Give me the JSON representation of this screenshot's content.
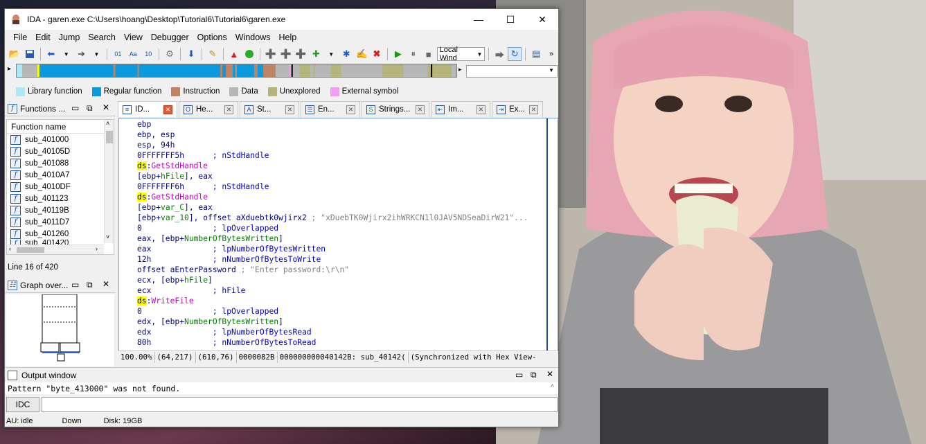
{
  "window": {
    "title": "IDA - garen.exe C:\\Users\\hoang\\Desktop\\Tutorial6\\Tutorial6\\garen.exe",
    "minimize": "—",
    "maximize": "☐",
    "close": "✕"
  },
  "menu": [
    "File",
    "Edit",
    "Jump",
    "Search",
    "View",
    "Debugger",
    "Options",
    "Windows",
    "Help"
  ],
  "toolbar": {
    "debugger_select": "Local Wind"
  },
  "legend": [
    {
      "label": "Library function",
      "color": "#aee8f7"
    },
    {
      "label": "Regular function",
      "color": "#0b9ade"
    },
    {
      "label": "Instruction",
      "color": "#bf8263"
    },
    {
      "label": "Data",
      "color": "#b7b7b7"
    },
    {
      "label": "Unexplored",
      "color": "#b5b57a"
    },
    {
      "label": "External symbol",
      "color": "#f59cf5"
    }
  ],
  "functions_panel": {
    "title": "Functions ...",
    "column": "Function name",
    "items": [
      "sub_401000",
      "sub_40105D",
      "sub_401088",
      "sub_4010A7",
      "sub_4010DF",
      "sub_401123",
      "sub_40119B",
      "sub_4011D7",
      "sub_401260",
      "sub_401420"
    ]
  },
  "line_status": "Line 16 of 420",
  "graph_panel": {
    "title": "Graph over..."
  },
  "tabs": [
    {
      "label": "ID...",
      "icon": "disassembly-icon",
      "active": true
    },
    {
      "label": "He...",
      "icon": "hex-view-icon"
    },
    {
      "label": "St...",
      "icon": "structures-icon"
    },
    {
      "label": "En...",
      "icon": "enums-icon"
    },
    {
      "label": "Strings...",
      "icon": "strings-icon"
    },
    {
      "label": "Im...",
      "icon": "imports-icon"
    },
    {
      "label": "Ex...",
      "icon": "exports-icon"
    }
  ],
  "disassembly": [
    [
      {
        "t": "ebp",
        "c": "op"
      }
    ],
    [
      {
        "t": "ebp, esp",
        "c": "op"
      }
    ],
    [
      {
        "t": "esp, 94h",
        "c": "op"
      }
    ],
    [
      {
        "t": "0FFFFFFF5h      ",
        "c": "op"
      },
      {
        "t": "; nStdHandle",
        "c": "cmt"
      }
    ],
    [
      {
        "t": "ds",
        "c": "seg"
      },
      {
        "t": ":",
        "c": "op"
      },
      {
        "t": "GetStdHandle",
        "c": "api"
      }
    ],
    [
      {
        "t": "[ebp+",
        "c": "op"
      },
      {
        "t": "hFile",
        "c": "var"
      },
      {
        "t": "], eax",
        "c": "op"
      }
    ],
    [
      {
        "t": "0FFFFFFF6h      ",
        "c": "op"
      },
      {
        "t": "; nStdHandle",
        "c": "cmt"
      }
    ],
    [
      {
        "t": "ds",
        "c": "seg"
      },
      {
        "t": ":",
        "c": "op"
      },
      {
        "t": "GetStdHandle",
        "c": "api"
      }
    ],
    [
      {
        "t": "[ebp+",
        "c": "op"
      },
      {
        "t": "var_C",
        "c": "var"
      },
      {
        "t": "], eax",
        "c": "op"
      }
    ],
    [
      {
        "t": "[ebp+",
        "c": "op"
      },
      {
        "t": "var_10",
        "c": "var"
      },
      {
        "t": "], offset aXduebtk0wjirx2 ",
        "c": "op"
      },
      {
        "t": "; \"xDuebTK0Wjirx2ihWRKCN1l0JAV5NDSeaDirW21\"...",
        "c": "str"
      }
    ],
    [
      {
        "t": "0               ",
        "c": "op"
      },
      {
        "t": "; lpOverlapped",
        "c": "cmt"
      }
    ],
    [
      {
        "t": "eax, [ebp+",
        "c": "op"
      },
      {
        "t": "NumberOfBytesWritten",
        "c": "var"
      },
      {
        "t": "]",
        "c": "op"
      }
    ],
    [
      {
        "t": "eax             ",
        "c": "op"
      },
      {
        "t": "; lpNumberOfBytesWritten",
        "c": "cmt"
      }
    ],
    [
      {
        "t": "12h             ",
        "c": "op"
      },
      {
        "t": "; nNumberOfBytesToWrite",
        "c": "cmt"
      }
    ],
    [
      {
        "t": "offset aEnterPassword ",
        "c": "op"
      },
      {
        "t": "; \"Enter password:\\r\\n\"",
        "c": "str"
      }
    ],
    [
      {
        "t": "ecx, [ebp+",
        "c": "op"
      },
      {
        "t": "hFile",
        "c": "var"
      },
      {
        "t": "]",
        "c": "op"
      }
    ],
    [
      {
        "t": "ecx             ",
        "c": "op"
      },
      {
        "t": "; hFile",
        "c": "cmt"
      }
    ],
    [
      {
        "t": "ds",
        "c": "seg"
      },
      {
        "t": ":",
        "c": "op"
      },
      {
        "t": "WriteFile",
        "c": "api"
      }
    ],
    [
      {
        "t": "0               ",
        "c": "op"
      },
      {
        "t": "; lpOverlapped",
        "c": "cmt"
      }
    ],
    [
      {
        "t": "edx, [ebp+",
        "c": "op"
      },
      {
        "t": "NumberOfBytesWritten",
        "c": "var"
      },
      {
        "t": "]",
        "c": "op"
      }
    ],
    [
      {
        "t": "edx             ",
        "c": "op"
      },
      {
        "t": "; lpNumberOfBytesRead",
        "c": "cmt"
      }
    ],
    [
      {
        "t": "80h             ",
        "c": "op"
      },
      {
        "t": "; nNumberOfBytesToRead",
        "c": "cmt"
      }
    ]
  ],
  "disasm_status": [
    "100.00%",
    "(64,217)",
    "(610,76)",
    "0000082B",
    "000000000040142B: sub_40142(",
    "(Synchronized with Hex View-"
  ],
  "output": {
    "title": "Output window",
    "text": "Pattern \"byte_413000\" was not found."
  },
  "idc_button": "IDC",
  "statusbar": [
    "AU:  idle",
    "Down",
    "Disk: 19GB"
  ],
  "colors": {
    "accent": "#1f4f9a",
    "segment_highlight": "#ffff00",
    "api_name": "#c000c0",
    "variable": "#008000",
    "comment": "#0000c0"
  }
}
